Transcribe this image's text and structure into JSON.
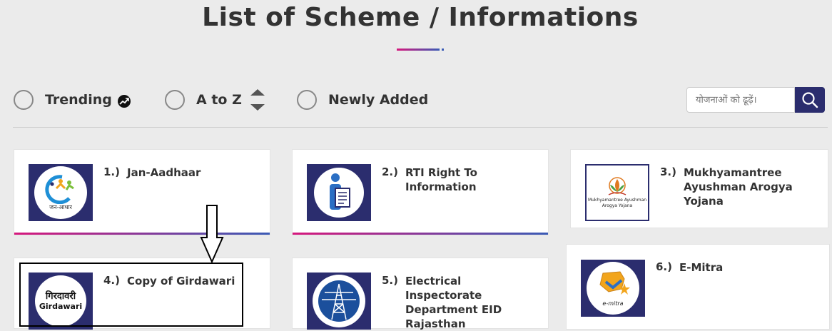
{
  "page": {
    "title": "List of Scheme / Informations"
  },
  "sort": {
    "trending_label": "Trending",
    "atoz_label": "A to Z",
    "newly_label": "Newly Added"
  },
  "search": {
    "placeholder": "योजनाओं को ढूढ़ें।"
  },
  "schemes": [
    {
      "number": "1.)",
      "name": "Jan-Aadhaar",
      "logo_text": "जन-आधार"
    },
    {
      "number": "2.)",
      "name": "RTI Right To Information"
    },
    {
      "number": "3.)",
      "name": "Mukhyamantree Ayushman Arogya Yojana",
      "logo_text_1": "Mukhyamantree Ayushman",
      "logo_text_2": "Arogya Yojana"
    },
    {
      "number": "4.)",
      "name": "Copy of Girdawari",
      "logo_text_1": "गिरदावरी",
      "logo_text_2": "Girdawari"
    },
    {
      "number": "5.)",
      "name": "Electrical Inspectorate Department EID Rajasthan"
    },
    {
      "number": "6.)",
      "name": "E-Mitra",
      "logo_text": "e-mitra"
    }
  ],
  "colors": {
    "background": "#ebebeb",
    "logo_navy": "#2b2d6e",
    "accent_pink": "#d6187d",
    "accent_blue": "#3b5bb5"
  }
}
